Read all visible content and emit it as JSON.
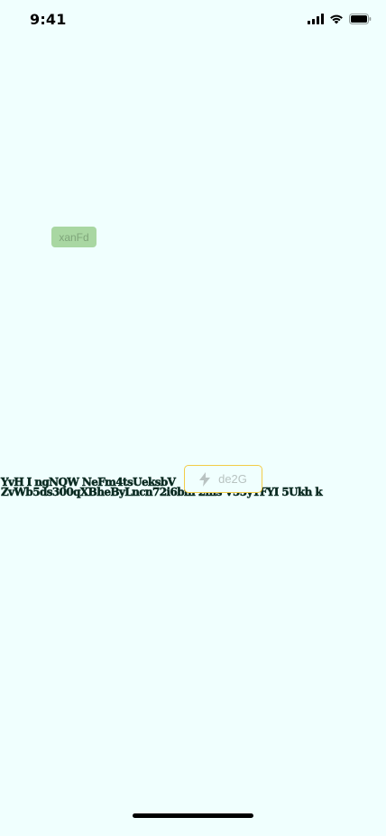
{
  "status_bar": {
    "time": "9:41",
    "icons": [
      "cellular-signal-icon",
      "wifi-icon",
      "battery-icon"
    ]
  },
  "chip": {
    "label": "xanFd",
    "color": "#a9d7a2"
  },
  "headline": {
    "lines": [
      "YvH I ngNQW NeFm4tsUeksbV",
      "ZvWb5ds300qXBheByLncn72i6bm 2ms V55yYFYI 5Ukh k"
    ]
  },
  "action_button": {
    "label": "de2G",
    "icon": "lightning-bolt-icon",
    "border_color": "#f2cc48"
  },
  "colors": {
    "background": "#f0fffe",
    "headline_text": "#0b2b22"
  }
}
